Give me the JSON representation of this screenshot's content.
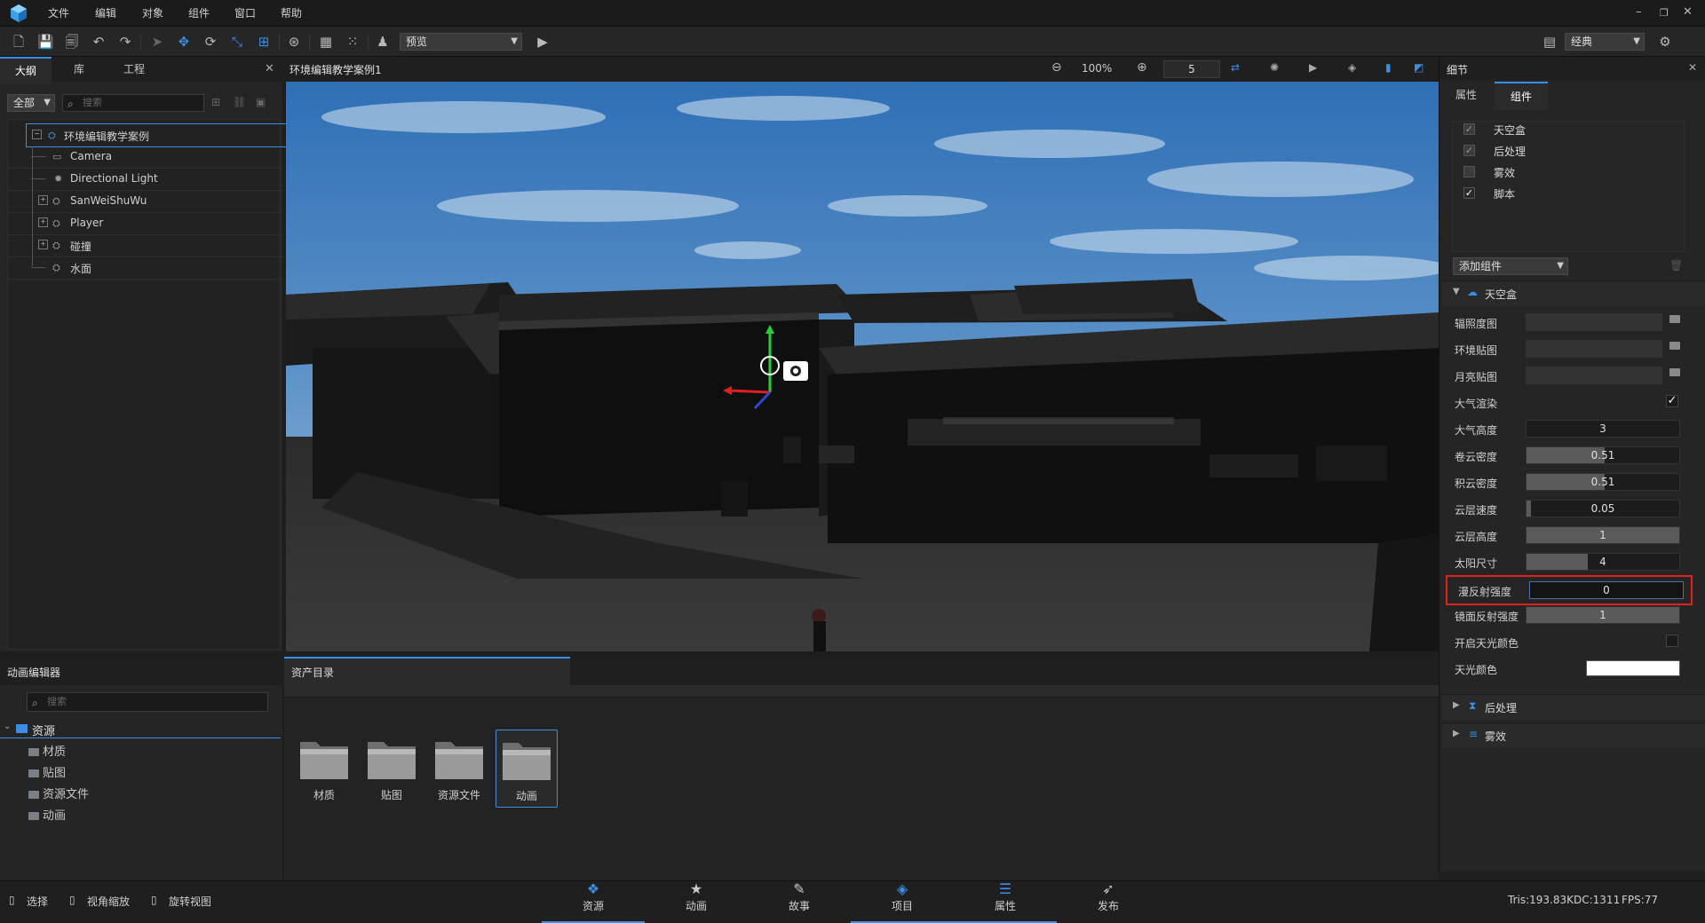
{
  "menubar": {
    "items": [
      "文件",
      "编辑",
      "对象",
      "组件",
      "窗口",
      "帮助"
    ]
  },
  "toolbar": {
    "preview_mode": "预览",
    "layout_mode": "经典"
  },
  "outline_panel": {
    "tabs": [
      "大纲",
      "库",
      "工程"
    ],
    "filter": "全部",
    "search_placeholder": "搜索",
    "tree": [
      {
        "label": "环境编辑教学案例",
        "icon": "scene-icon",
        "level": 0,
        "expandable": true
      },
      {
        "label": "Camera",
        "icon": "camera-icon",
        "level": 1,
        "expandable": false
      },
      {
        "label": "Directional Light",
        "icon": "light-icon",
        "level": 1,
        "expandable": false
      },
      {
        "label": "SanWeiShuWu",
        "icon": "object-icon",
        "level": 1,
        "expandable": true
      },
      {
        "label": "Player",
        "icon": "object-icon",
        "level": 1,
        "expandable": true
      },
      {
        "label": "碰撞",
        "icon": "object-icon",
        "level": 1,
        "expandable": true
      },
      {
        "label": "水面",
        "icon": "object-icon",
        "level": 1,
        "expandable": false
      }
    ]
  },
  "viewport": {
    "title": "环境编辑教学案例1",
    "zoom": "100%",
    "speed": "5"
  },
  "details_panel": {
    "title": "细节",
    "tabs": [
      "属性",
      "组件"
    ],
    "components": [
      {
        "label": "天空盒",
        "checked": true,
        "dim": true
      },
      {
        "label": "后处理",
        "checked": true,
        "dim": true
      },
      {
        "label": "雾效",
        "checked": false,
        "dim": false
      },
      {
        "label": "脚本",
        "checked": true,
        "dim": false
      }
    ],
    "add_component": "添加组件",
    "skybox_section": "天空盒",
    "properties": [
      {
        "label": "辐照度图",
        "kind": "file",
        "value": ""
      },
      {
        "label": "环境贴图",
        "kind": "file",
        "value": ""
      },
      {
        "label": "月亮贴图",
        "kind": "file",
        "value": ""
      },
      {
        "label": "大气渲染",
        "kind": "check",
        "value": "✓"
      },
      {
        "label": "大气高度",
        "kind": "number",
        "value": "3",
        "fill": 0
      },
      {
        "label": "卷云密度",
        "kind": "slider",
        "value": "0.51",
        "fill": 0.51
      },
      {
        "label": "积云密度",
        "kind": "slider",
        "value": "0.51",
        "fill": 0.51
      },
      {
        "label": "云层速度",
        "kind": "slider",
        "value": "0.05",
        "fill": 0.03
      },
      {
        "label": "云层高度",
        "kind": "slider",
        "value": "1",
        "fill": 1.0
      },
      {
        "label": "太阳尺寸",
        "kind": "slider",
        "value": "4",
        "fill": 0.4
      },
      {
        "label": "漫反射强度",
        "kind": "number",
        "value": "0",
        "fill": 0,
        "highlight": true
      },
      {
        "label": "镜面反射强度",
        "kind": "slider",
        "value": "1",
        "fill": 1.0
      },
      {
        "label": "开启天光颜色",
        "kind": "check",
        "value": ""
      },
      {
        "label": "天光颜色",
        "kind": "color",
        "value": ""
      }
    ],
    "collapsed_sections": [
      "后处理",
      "雾效"
    ]
  },
  "anim_editor": {
    "title": "动画编辑器",
    "search_placeholder": "搜索",
    "root": "资源",
    "children": [
      "材质",
      "贴图",
      "资源文件",
      "动画"
    ]
  },
  "asset_browser": {
    "title": "资产目录",
    "folders": [
      "材质",
      "贴图",
      "资源文件",
      "动画"
    ]
  },
  "status": {
    "select": "选择",
    "zoom_view": "视角缩放",
    "rotate_view": "旋转视图",
    "tris": "Tris:193.83K",
    "dc": "DC:1311",
    "fps": "FPS:77"
  },
  "bottom_tabs": [
    "资源",
    "动画",
    "故事",
    "项目",
    "属性",
    "发布"
  ],
  "colors": {
    "accent": "#3a8ee6",
    "highlight_border": "#e02020"
  }
}
